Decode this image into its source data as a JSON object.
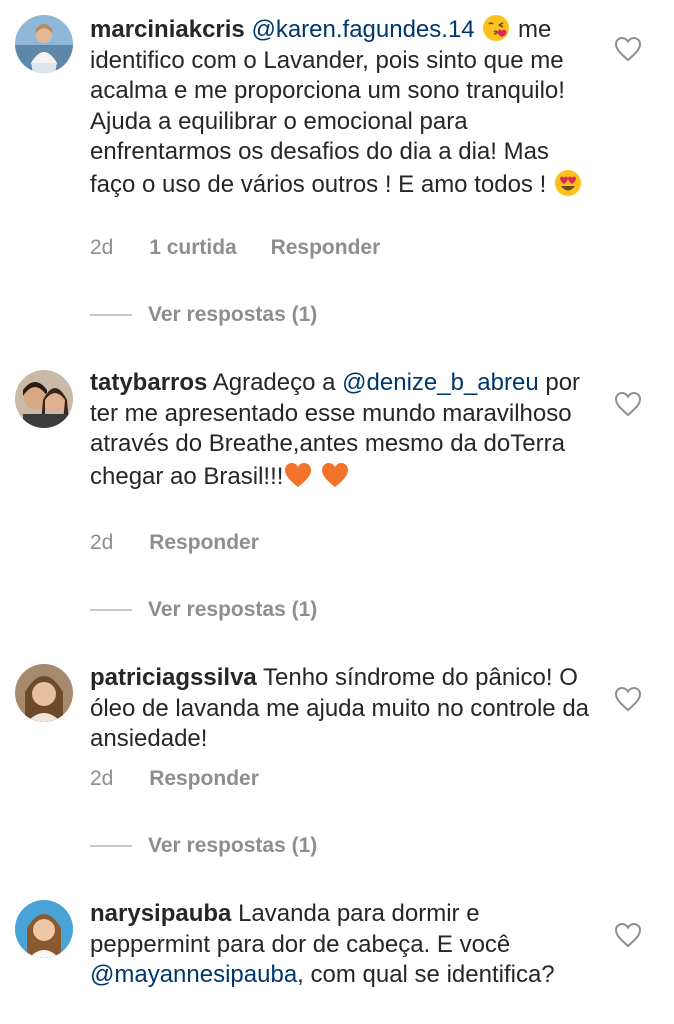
{
  "comments": [
    {
      "username": "marciniakcris",
      "mention": "@karen.fagundes.14",
      "text": "me identifico com o Lavander, pois sinto que me acalma e me proporciona um sono tranquilo! Ajuda a equilibrar o emocional para enfrentarmos os desafios do dia a dia! Mas faço o uso de vários outros !  E amo todos !",
      "time": "2d",
      "likes": "1 curtida",
      "reply_label": "Responder",
      "view_replies": "Ver respostas (1)",
      "emojis": [
        "kissing-heart-emoji",
        "heart-eyes-emoji"
      ]
    },
    {
      "username": "tatybarros",
      "text_before": "Agradeço a",
      "mention": "@denize_b_abreu",
      "text": "por ter me apresentado esse mundo maravilhoso através do Breathe,antes mesmo da doTerra chegar ao Brasil!!!",
      "time": "2d",
      "reply_label": "Responder",
      "view_replies": "Ver respostas (1)",
      "emojis": [
        "orange-heart-emoji",
        "orange-heart-emoji"
      ]
    },
    {
      "username": "patriciagssilva",
      "text": "Tenho síndrome do pânico! O óleo de lavanda me ajuda muito no controle da ansiedade!",
      "time": "2d",
      "reply_label": "Responder",
      "view_replies": "Ver respostas (1)"
    },
    {
      "username": "narysipauba",
      "text": "Lavanda para dormir e peppermint para dor de cabeça. E você",
      "mention": "@mayannesipauba",
      "text_after": ", com qual se identifica?"
    }
  ],
  "colors": {
    "text": "#262626",
    "secondary": "#8e8e8e",
    "mention": "#00376b",
    "heart_outline": "#8e8e8e"
  },
  "icons": {
    "like": "heart-outline-icon"
  }
}
